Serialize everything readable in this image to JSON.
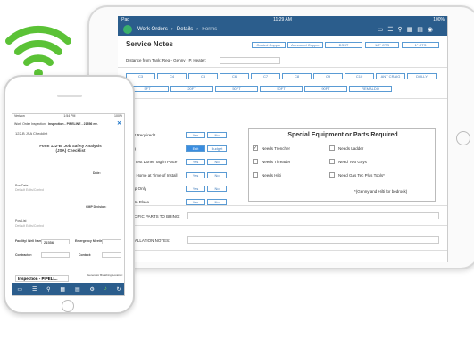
{
  "tablet": {
    "status_time": "11:29 AM",
    "status_left": "iPad",
    "status_right": "100%",
    "nav": {
      "work_orders": "Work Orders",
      "details": "Details",
      "forms": "Forms"
    },
    "section_title": "Service Notes",
    "top_tabs": [
      "Coated Copper",
      "Armoured Copper",
      "DSST",
      "1/2\" CTS",
      "1\" CTS"
    ],
    "distance_label": "Distance from Tank: Reg - Genny - P. Heater:",
    "row1": [
      "C3",
      "C4",
      "C5",
      "C6",
      "C7",
      "C8",
      "C9",
      "C10",
      "ANT CRAIG",
      "DOLLY"
    ],
    "row2": [
      "5FT",
      "20FT",
      "50FT",
      "50FT",
      "90FT",
      "REMALDO"
    ],
    "questions": [
      {
        "label": "Bump Out Required?",
        "a": "Yes",
        "b": "No"
      },
      {
        "label": "Trenching",
        "a": "Exit",
        "b": "Budget"
      },
      {
        "label": "Pressure Test Done/ Tag in Place",
        "a": "Yes",
        "b": "No"
      },
      {
        "label": "Someone Home at Time of Install",
        "a": "Yes",
        "b": "No"
      },
      {
        "label": "Work Drop Only",
        "a": "Yes",
        "b": "No"
      },
      {
        "label": "Pre Stub In Place",
        "a": "Yes",
        "b": "No"
      }
    ],
    "equipment": {
      "title": "Special Equipment or Parts Required",
      "items": [
        {
          "label": "Needs Trencher",
          "checked": true
        },
        {
          "label": "Needs Ladder",
          "checked": false
        },
        {
          "label": "Needs Threader",
          "checked": false
        },
        {
          "label": "Need Two Guys",
          "checked": false
        },
        {
          "label": "Needs Hilti",
          "checked": false
        },
        {
          "label": "Need Gas Tec Plus Tools*",
          "checked": false
        }
      ],
      "note": "*(Genny and Hilti for bedrock)"
    },
    "parts_label": "SPECIFIC PARTS TO BRING:",
    "install_label": "INSTALLATION NOTES:"
  },
  "phone": {
    "status_left": "Verizon",
    "status_time": "1:54 PM",
    "status_right": "100%",
    "nav_left": "Work Order Inspection",
    "nav_title": "Inspection - PIPELINE - 21556 mr.",
    "subtitle": "122-B JSA Checklist",
    "form_title": "Form 122-B, Job Safety Analysis (JSA) Checklist",
    "date_label": "Date:",
    "postdate_label": "PostDate",
    "postdate_hint": "Default Edits/Control",
    "cmp_label": "CMP Division:",
    "postlist_label": "PostList",
    "postlist_hint": "Default Edits/Control",
    "facility_label": "Facility/ Well Name:",
    "facility_value": "21556",
    "emergency_label": "Emergency Meeting Place:",
    "contractor_label": "Contractor:",
    "contact_label": "Contact:",
    "inspection_value": "Inspection - PIPELI...",
    "generator_label": "Generator Breathing Location:"
  }
}
